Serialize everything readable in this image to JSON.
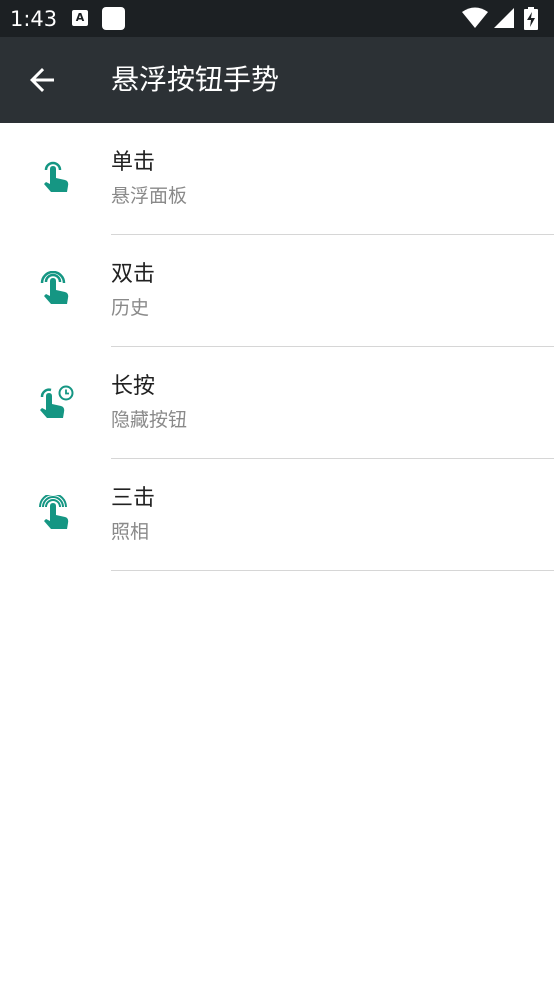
{
  "status_bar": {
    "time": "1:43",
    "notification_icon_letter": "A",
    "icons": [
      "a-notification-icon",
      "square-notification-icon",
      "wifi-icon",
      "cell-signal-icon",
      "battery-charging-icon"
    ]
  },
  "app_bar": {
    "title": "悬浮按钮手势",
    "back_icon": "arrow-back-icon"
  },
  "colors": {
    "status_bar": "#1c2023",
    "app_bar": "#2c3135",
    "accent": "#159683",
    "summary_text": "#8a8a8a",
    "divider": "#d6d6d6"
  },
  "items": [
    {
      "title": "单击",
      "summary": "悬浮面板",
      "icon": "single-tap-gesture-icon"
    },
    {
      "title": "双击",
      "summary": "历史",
      "icon": "double-tap-gesture-icon"
    },
    {
      "title": "长按",
      "summary": "隐藏按钮",
      "icon": "long-press-gesture-icon"
    },
    {
      "title": "三击",
      "summary": "照相",
      "icon": "triple-tap-gesture-icon"
    }
  ]
}
